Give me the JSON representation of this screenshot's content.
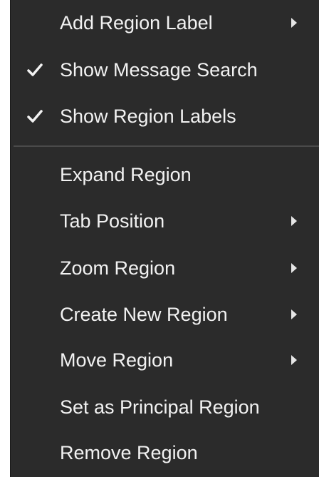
{
  "menu": {
    "items": [
      {
        "label": "Add Region Label",
        "checked": false,
        "submenu": true
      },
      {
        "label": "Show Message Search",
        "checked": true,
        "submenu": false
      },
      {
        "label": "Show Region Labels",
        "checked": true,
        "submenu": false
      },
      {
        "label": "Expand Region",
        "checked": false,
        "submenu": false
      },
      {
        "label": "Tab Position",
        "checked": false,
        "submenu": true
      },
      {
        "label": "Zoom Region",
        "checked": false,
        "submenu": true
      },
      {
        "label": "Create New Region",
        "checked": false,
        "submenu": true
      },
      {
        "label": "Move Region",
        "checked": false,
        "submenu": true
      },
      {
        "label": "Set as Principal Region",
        "checked": false,
        "submenu": false
      },
      {
        "label": "Remove Region",
        "checked": false,
        "submenu": false
      }
    ],
    "colors": {
      "background": "#2b2b2b",
      "text": "#f2f2f2",
      "separator": "#4a4a4a"
    }
  }
}
